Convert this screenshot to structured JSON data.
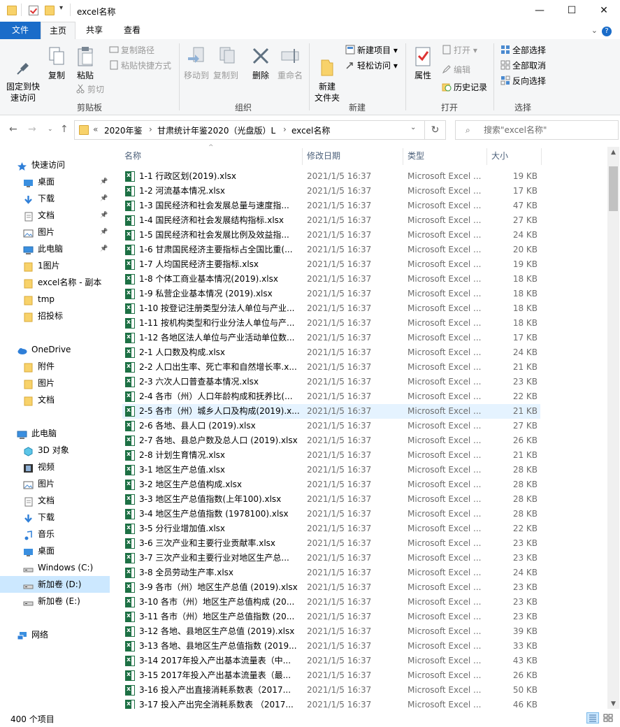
{
  "window": {
    "title": "excel名称",
    "minimize": "—",
    "maximize": "☐",
    "close": "✕"
  },
  "tabs": {
    "file": "文件",
    "home": "主页",
    "share": "共享",
    "view": "查看"
  },
  "ribbon": {
    "clipboard": {
      "label": "剪贴板",
      "pin": "固定到快\n速访问",
      "copy": "复制",
      "paste": "粘贴",
      "copy_path": "复制路径",
      "paste_shortcut": "粘贴快捷方式",
      "cut": "剪切"
    },
    "organize": {
      "label": "组织",
      "move_to": "移动到",
      "copy_to": "复制到",
      "delete": "删除",
      "rename": "重命名"
    },
    "new": {
      "label": "新建",
      "new_folder": "新建\n文件夹",
      "new_item": "新建项目",
      "easy_access": "轻松访问"
    },
    "open": {
      "label": "打开",
      "properties": "属性",
      "open": "打开",
      "edit": "编辑",
      "history": "历史记录"
    },
    "select": {
      "label": "选择",
      "select_all": "全部选择",
      "select_none": "全部取消",
      "invert": "反向选择"
    }
  },
  "address": {
    "prefix": "«",
    "path": [
      "2020年鉴",
      "甘肃统计年鉴2020（光盘版）L",
      "excel名称"
    ],
    "separator": "›",
    "search_placeholder": "搜索\"excel名称\""
  },
  "sidebar": [
    {
      "label": "快速访问",
      "icon": "star-icon",
      "indent": 0,
      "pinned": false
    },
    {
      "label": "桌面",
      "icon": "desktop-icon",
      "indent": 1,
      "pinned": true
    },
    {
      "label": "下载",
      "icon": "download-icon",
      "indent": 1,
      "pinned": true
    },
    {
      "label": "文档",
      "icon": "document-icon",
      "indent": 1,
      "pinned": true
    },
    {
      "label": "图片",
      "icon": "picture-icon",
      "indent": 1,
      "pinned": true
    },
    {
      "label": "此电脑",
      "icon": "computer-icon",
      "indent": 1,
      "pinned": true
    },
    {
      "label": "1图片",
      "icon": "folder-icon",
      "indent": 1,
      "pinned": false
    },
    {
      "label": "excel名称 - 副本",
      "icon": "folder-icon",
      "indent": 1,
      "pinned": false
    },
    {
      "label": "tmp",
      "icon": "folder-icon",
      "indent": 1,
      "pinned": false
    },
    {
      "label": "招投标",
      "icon": "folder-icon",
      "indent": 1,
      "pinned": false
    },
    {
      "label": "",
      "icon": "",
      "indent": 0,
      "pinned": false
    },
    {
      "label": "OneDrive",
      "icon": "cloud-icon",
      "indent": 0,
      "pinned": false
    },
    {
      "label": "附件",
      "icon": "folder-icon",
      "indent": 1,
      "pinned": false
    },
    {
      "label": "图片",
      "icon": "folder-icon",
      "indent": 1,
      "pinned": false
    },
    {
      "label": "文档",
      "icon": "folder-icon",
      "indent": 1,
      "pinned": false
    },
    {
      "label": "",
      "icon": "",
      "indent": 0,
      "pinned": false
    },
    {
      "label": "此电脑",
      "icon": "computer-icon",
      "indent": 0,
      "pinned": false
    },
    {
      "label": "3D 对象",
      "icon": "3d-objects-icon",
      "indent": 1,
      "pinned": false
    },
    {
      "label": "视频",
      "icon": "video-icon",
      "indent": 1,
      "pinned": false
    },
    {
      "label": "图片",
      "icon": "picture-icon",
      "indent": 1,
      "pinned": false
    },
    {
      "label": "文档",
      "icon": "document-icon",
      "indent": 1,
      "pinned": false
    },
    {
      "label": "下载",
      "icon": "download-icon",
      "indent": 1,
      "pinned": false
    },
    {
      "label": "音乐",
      "icon": "music-icon",
      "indent": 1,
      "pinned": false
    },
    {
      "label": "桌面",
      "icon": "desktop-icon",
      "indent": 1,
      "pinned": false
    },
    {
      "label": "Windows (C:)",
      "icon": "drive-icon",
      "indent": 1,
      "pinned": false
    },
    {
      "label": "新加卷 (D:)",
      "icon": "drive-icon",
      "indent": 1,
      "pinned": false,
      "selected": true
    },
    {
      "label": "新加卷 (E:)",
      "icon": "drive-icon",
      "indent": 1,
      "pinned": false
    },
    {
      "label": "",
      "icon": "",
      "indent": 0,
      "pinned": false
    },
    {
      "label": "网络",
      "icon": "network-icon",
      "indent": 0,
      "pinned": false
    }
  ],
  "columns": {
    "name": "名称",
    "date": "修改日期",
    "type": "类型",
    "size": "大小"
  },
  "files": [
    {
      "name": "1-1  行政区划(2019).xlsx",
      "date": "2021/1/5 16:37",
      "type": "Microsoft Excel ...",
      "size": "19 KB"
    },
    {
      "name": "1-2  河流基本情况.xlsx",
      "date": "2021/1/5 16:37",
      "type": "Microsoft Excel ...",
      "size": "17 KB"
    },
    {
      "name": "1-3  国民经济和社会发展总量与速度指...",
      "date": "2021/1/5 16:37",
      "type": "Microsoft Excel ...",
      "size": "47 KB"
    },
    {
      "name": "1-4  国民经济和社会发展结构指标.xlsx",
      "date": "2021/1/5 16:37",
      "type": "Microsoft Excel ...",
      "size": "27 KB"
    },
    {
      "name": "1-5  国民经济和社会发展比例及效益指...",
      "date": "2021/1/5 16:37",
      "type": "Microsoft Excel ...",
      "size": "24 KB"
    },
    {
      "name": "1-6  甘肃国民经济主要指标占全国比重(...",
      "date": "2021/1/5 16:37",
      "type": "Microsoft Excel ...",
      "size": "20 KB"
    },
    {
      "name": "1-7  人均国民经济主要指标.xlsx",
      "date": "2021/1/5 16:37",
      "type": "Microsoft Excel ...",
      "size": "19 KB"
    },
    {
      "name": "1-8  个体工商业基本情况(2019).xlsx",
      "date": "2021/1/5 16:37",
      "type": "Microsoft Excel ...",
      "size": "18 KB"
    },
    {
      "name": "1-9  私营企业基本情况 (2019).xlsx",
      "date": "2021/1/5 16:37",
      "type": "Microsoft Excel ...",
      "size": "18 KB"
    },
    {
      "name": "1-10  按登记注册类型分法人单位与产业...",
      "date": "2021/1/5 16:37",
      "type": "Microsoft Excel ...",
      "size": "18 KB"
    },
    {
      "name": "1-11  按机构类型和行业分法人单位与产...",
      "date": "2021/1/5 16:37",
      "type": "Microsoft Excel ...",
      "size": "18 KB"
    },
    {
      "name": "1-12  各地区法人单位与产业活动单位数...",
      "date": "2021/1/5 16:37",
      "type": "Microsoft Excel ...",
      "size": "17 KB"
    },
    {
      "name": "2-1  人口数及构成.xlsx",
      "date": "2021/1/5 16:37",
      "type": "Microsoft Excel ...",
      "size": "24 KB"
    },
    {
      "name": "2-2  人口出生率、死亡率和自然增长率.x...",
      "date": "2021/1/5 16:37",
      "type": "Microsoft Excel ...",
      "size": "21 KB"
    },
    {
      "name": "2-3  六次人口普查基本情况.xlsx",
      "date": "2021/1/5 16:37",
      "type": "Microsoft Excel ...",
      "size": "23 KB"
    },
    {
      "name": "2-4  各市（州）人口年龄构成和抚养比(...",
      "date": "2021/1/5 16:37",
      "type": "Microsoft Excel ...",
      "size": "22 KB"
    },
    {
      "name": "2-5  各市（州）城乡人口及构成(2019).x...",
      "date": "2021/1/5 16:37",
      "type": "Microsoft Excel ...",
      "size": "21 KB",
      "highlight": true
    },
    {
      "name": "2-6  各地、县人口 (2019).xlsx",
      "date": "2021/1/5 16:37",
      "type": "Microsoft Excel ...",
      "size": "27 KB"
    },
    {
      "name": "2-7  各地、县总户数及总人口 (2019).xlsx",
      "date": "2021/1/5 16:37",
      "type": "Microsoft Excel ...",
      "size": "26 KB"
    },
    {
      "name": "2-8  计划生育情况.xlsx",
      "date": "2021/1/5 16:37",
      "type": "Microsoft Excel ...",
      "size": "21 KB"
    },
    {
      "name": "3-1  地区生产总值.xlsx",
      "date": "2021/1/5 16:37",
      "type": "Microsoft Excel ...",
      "size": "28 KB"
    },
    {
      "name": "3-2  地区生产总值构成.xlsx",
      "date": "2021/1/5 16:37",
      "type": "Microsoft Excel ...",
      "size": "28 KB"
    },
    {
      "name": "3-3  地区生产总值指数(上年100).xlsx",
      "date": "2021/1/5 16:37",
      "type": "Microsoft Excel ...",
      "size": "28 KB"
    },
    {
      "name": "3-4  地区生产总值指数 (1978100).xlsx",
      "date": "2021/1/5 16:37",
      "type": "Microsoft Excel ...",
      "size": "28 KB"
    },
    {
      "name": "3-5  分行业增加值.xlsx",
      "date": "2021/1/5 16:37",
      "type": "Microsoft Excel ...",
      "size": "22 KB"
    },
    {
      "name": "3-6  三次产业和主要行业贡献率.xlsx",
      "date": "2021/1/5 16:37",
      "type": "Microsoft Excel ...",
      "size": "23 KB"
    },
    {
      "name": "3-7  三次产业和主要行业对地区生产总...",
      "date": "2021/1/5 16:37",
      "type": "Microsoft Excel ...",
      "size": "23 KB"
    },
    {
      "name": "3-8  全员劳动生产率.xlsx",
      "date": "2021/1/5 16:37",
      "type": "Microsoft Excel ...",
      "size": "24 KB"
    },
    {
      "name": "3-9  各市（州）地区生产总值 (2019).xlsx",
      "date": "2021/1/5 16:37",
      "type": "Microsoft Excel ...",
      "size": "23 KB"
    },
    {
      "name": "3-10  各市（州）地区生产总值构成 (20...",
      "date": "2021/1/5 16:37",
      "type": "Microsoft Excel ...",
      "size": "23 KB"
    },
    {
      "name": "3-11  各市（州）地区生产总值指数 (20...",
      "date": "2021/1/5 16:37",
      "type": "Microsoft Excel ...",
      "size": "23 KB"
    },
    {
      "name": "3-12  各地、县地区生产总值 (2019).xlsx",
      "date": "2021/1/5 16:37",
      "type": "Microsoft Excel ...",
      "size": "39 KB"
    },
    {
      "name": "3-13  各地、县地区生产总值指数 (2019...",
      "date": "2021/1/5 16:37",
      "type": "Microsoft Excel ...",
      "size": "33 KB"
    },
    {
      "name": "3-14  2017年投入产出基本流量表（中...",
      "date": "2021/1/5 16:37",
      "type": "Microsoft Excel ...",
      "size": "43 KB"
    },
    {
      "name": "3-15  2017年投入产出基本流量表（最...",
      "date": "2021/1/5 16:37",
      "type": "Microsoft Excel ...",
      "size": "26 KB"
    },
    {
      "name": "3-16  投入产出直接消耗系数表（2017...",
      "date": "2021/1/5 16:37",
      "type": "Microsoft Excel ...",
      "size": "50 KB"
    },
    {
      "name": "3-17  投入产出完全消耗系数表 （2017...",
      "date": "2021/1/5 16:37",
      "type": "Microsoft Excel ...",
      "size": "46 KB"
    }
  ],
  "status": {
    "count": "400 个项目"
  },
  "colors": {
    "accent": "#1a6cc9",
    "selected": "#cce8ff",
    "hover": "#e5f3ff",
    "excel": "#1d7044"
  }
}
